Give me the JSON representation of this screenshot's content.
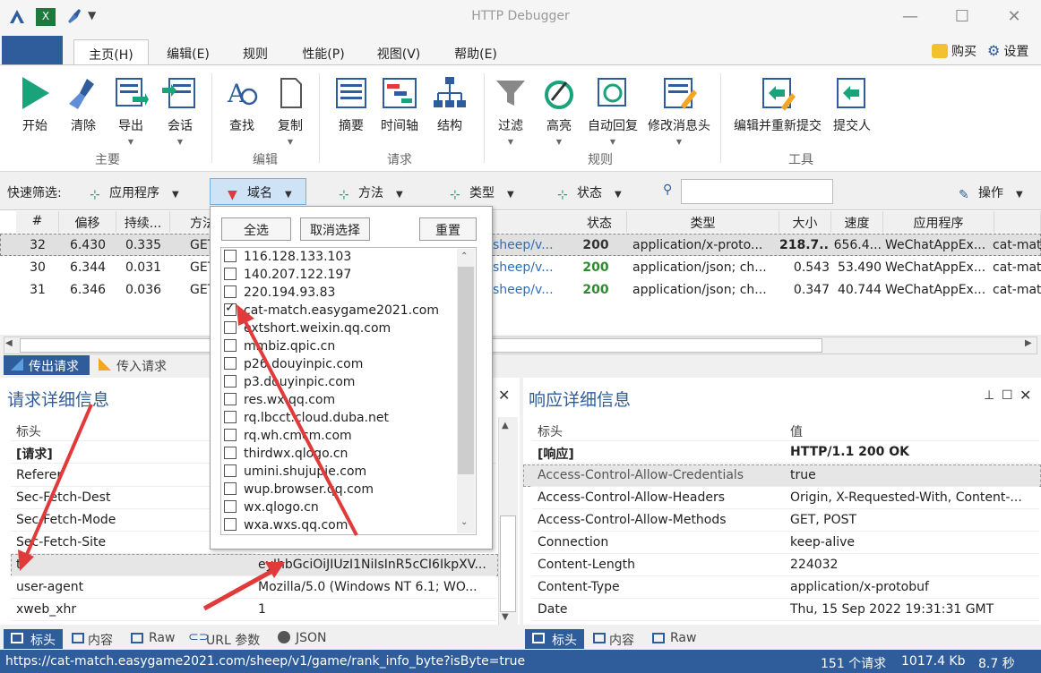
{
  "window": {
    "title": "HTTP Debugger"
  },
  "menu_tabs": [
    "主页(H)",
    "编辑(E)",
    "规则",
    "性能(P)",
    "视图(V)",
    "帮助(E)"
  ],
  "top_right": {
    "buy": "购买",
    "settings": "设置"
  },
  "ribbon": {
    "buttons": [
      "开始",
      "清除",
      "导出",
      "会话",
      "查找",
      "复制",
      "摘要",
      "时间轴",
      "结构",
      "过滤",
      "高亮",
      "自动回复",
      "修改消息头",
      "编辑并重新提交",
      "提交人"
    ],
    "groups": [
      "主要",
      "编辑",
      "请求",
      "规则",
      "工具"
    ]
  },
  "filterbar": {
    "label": "快速筛选:",
    "app": "应用程序",
    "domain": "域名",
    "method": "方法",
    "type": "类型",
    "status": "状态",
    "search_value": "",
    "ops": "操作"
  },
  "grid": {
    "headers": [
      "#",
      "偏移",
      "持续...",
      "方法",
      "状态",
      "类型",
      "大小",
      "速度",
      "应用程序"
    ],
    "rows": [
      {
        "n": "32",
        "offset": "6.430",
        "dur": "0.335",
        "method": "GET",
        "url": "sheep/v...",
        "status": "200",
        "type": "application/x-proto...",
        "size": "218.7...",
        "speed": "656.4...",
        "app": "WeChatAppEx...",
        "host": "cat-mat"
      },
      {
        "n": "30",
        "offset": "6.344",
        "dur": "0.031",
        "method": "GET",
        "url": "sheep/v...",
        "status": "200",
        "type": "application/json; ch...",
        "size": "0.543",
        "speed": "53.490",
        "app": "WeChatAppEx...",
        "host": "cat-mat"
      },
      {
        "n": "31",
        "offset": "6.346",
        "dur": "0.036",
        "method": "GET",
        "url": "sheep/v...",
        "status": "200",
        "type": "application/json; ch...",
        "size": "0.347",
        "speed": "40.744",
        "app": "WeChatAppEx...",
        "host": "cat-mat"
      }
    ]
  },
  "direction_tabs": {
    "out": "传出请求",
    "in": "传入请求"
  },
  "request_panel": {
    "title": "请求详细信息",
    "header_col": "标头",
    "rows": [
      {
        "k": "[请求]",
        "v": "",
        "bold": true
      },
      {
        "k": "Referer",
        "v": ""
      },
      {
        "k": "Sec-Fetch-Dest",
        "v": ""
      },
      {
        "k": "Sec-Fetch-Mode",
        "v": ""
      },
      {
        "k": "Sec-Fetch-Site",
        "v": ""
      },
      {
        "k": "t",
        "v": "eyJhbGciOiJIUzI1NiIsInR5cCI6IkpXV..."
      },
      {
        "k": "user-agent",
        "v": "Mozilla/5.0 (Windows NT 6.1; WO..."
      },
      {
        "k": "xweb_xhr",
        "v": "1"
      }
    ],
    "tabs": [
      "标头",
      "内容",
      "Raw",
      "URL 参数",
      "JSON"
    ]
  },
  "response_panel": {
    "title": "响应详细信息",
    "header_col": "标头",
    "value_col": "值",
    "rows": [
      {
        "k": "[响应]",
        "v": "HTTP/1.1 200 OK",
        "bold": true
      },
      {
        "k": "Access-Control-Allow-Credentials",
        "v": "true"
      },
      {
        "k": "Access-Control-Allow-Headers",
        "v": "Origin, X-Requested-With, Content-..."
      },
      {
        "k": "Access-Control-Allow-Methods",
        "v": "GET, POST"
      },
      {
        "k": "Connection",
        "v": "keep-alive"
      },
      {
        "k": "Content-Length",
        "v": "224032"
      },
      {
        "k": "Content-Type",
        "v": "application/x-protobuf"
      },
      {
        "k": "Date",
        "v": "Thu, 15 Sep 2022 19:31:31 GMT"
      }
    ],
    "tabs": [
      "标头",
      "内容",
      "Raw"
    ]
  },
  "domain_popup": {
    "buttons": [
      "全选",
      "取消选择",
      "重置"
    ],
    "items": [
      {
        "label": "116.128.133.103",
        "checked": false
      },
      {
        "label": "140.207.122.197",
        "checked": false
      },
      {
        "label": "220.194.93.83",
        "checked": false
      },
      {
        "label": "cat-match.easygame2021.com",
        "checked": true
      },
      {
        "label": "extshort.weixin.qq.com",
        "checked": false
      },
      {
        "label": "mmbiz.qpic.cn",
        "checked": false
      },
      {
        "label": "p26.douyinpic.com",
        "checked": false
      },
      {
        "label": "p3.douyinpic.com",
        "checked": false
      },
      {
        "label": "res.wx.qq.com",
        "checked": false
      },
      {
        "label": "rq.lbcct.cloud.duba.net",
        "checked": false
      },
      {
        "label": "rq.wh.cmcm.com",
        "checked": false
      },
      {
        "label": "thirdwx.qlogo.cn",
        "checked": false
      },
      {
        "label": "umini.shujupie.com",
        "checked": false
      },
      {
        "label": "wup.browser.qq.com",
        "checked": false
      },
      {
        "label": "wx.qlogo.cn",
        "checked": false
      },
      {
        "label": "wxa.wxs.qq.com",
        "checked": false
      }
    ]
  },
  "status": {
    "url": "https://cat-match.easygame2021.com/sheep/v1/game/rank_info_byte?isByte=true",
    "count": "151 个请求",
    "size": "1017.4 Kb",
    "time": "8.7 秒"
  },
  "colors": {
    "accent": "#2f5c9a",
    "status_green": "#2e8b2e",
    "arrow_red": "#e03a3a"
  }
}
